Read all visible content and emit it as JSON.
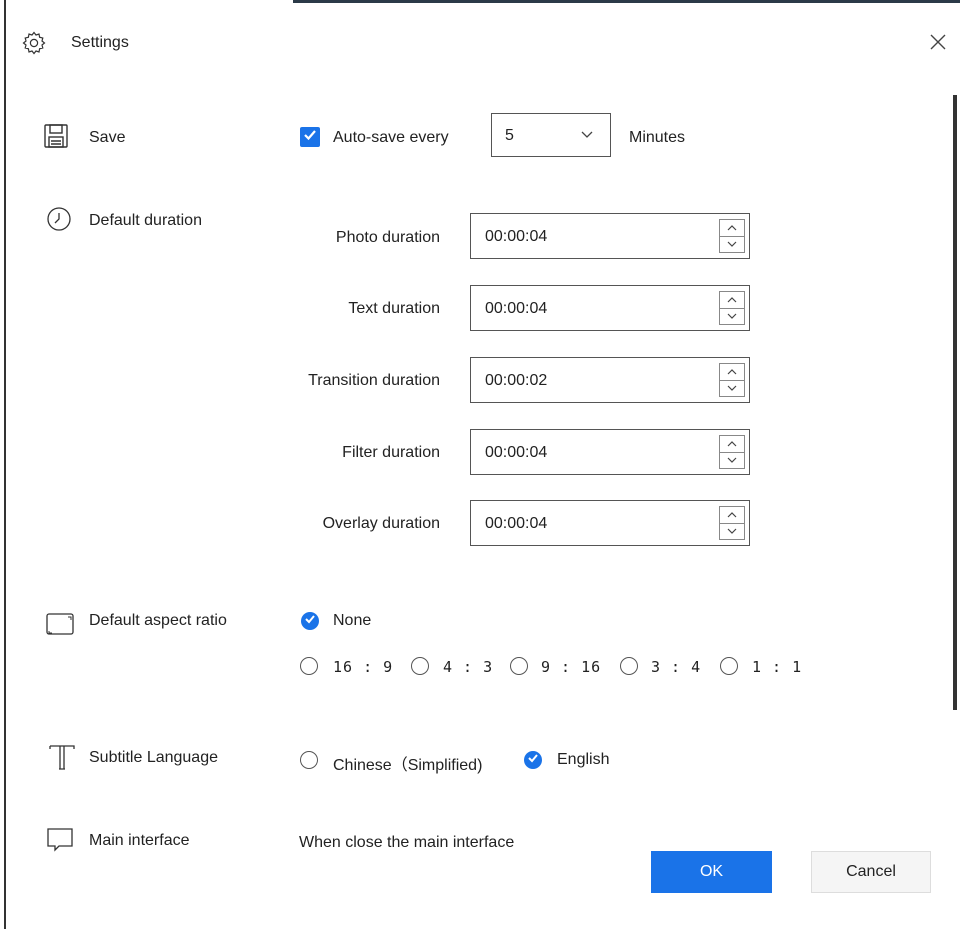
{
  "window": {
    "title": "Settings",
    "title_icon": "gear-icon",
    "close_icon": "close-icon"
  },
  "save": {
    "label": "Save",
    "icon": "floppy-disk-icon",
    "autosave_checked": true,
    "autosave_label": "Auto-save every",
    "interval_value": "5",
    "unit": "Minutes"
  },
  "duration": {
    "label": "Default duration",
    "icon": "clock-icon",
    "rows": [
      {
        "label": "Photo duration",
        "value": "00:00:04"
      },
      {
        "label": "Text duration",
        "value": "00:00:04"
      },
      {
        "label": "Transition duration",
        "value": "00:00:02"
      },
      {
        "label": "Filter duration",
        "value": "00:00:04"
      },
      {
        "label": "Overlay duration",
        "value": "00:00:04"
      }
    ]
  },
  "aspect": {
    "label": "Default aspect ratio",
    "icon": "aspect-ratio-icon",
    "none_label": "None",
    "selected": "None",
    "options": [
      "16 : 9",
      "4 : 3",
      "9 : 16",
      "3 : 4",
      "1 : 1"
    ]
  },
  "subtitle": {
    "label": "Subtitle Language",
    "icon": "text-icon",
    "options": [
      "Chinese（Simplified)",
      "English"
    ],
    "selected": "English"
  },
  "main_interface": {
    "label": "Main interface",
    "icon": "chat-bubble-icon",
    "description": "When close the main interface"
  },
  "buttons": {
    "ok": "OK",
    "cancel": "Cancel"
  },
  "colors": {
    "accent": "#1a73e8",
    "top_bar": "#2b3a48"
  }
}
